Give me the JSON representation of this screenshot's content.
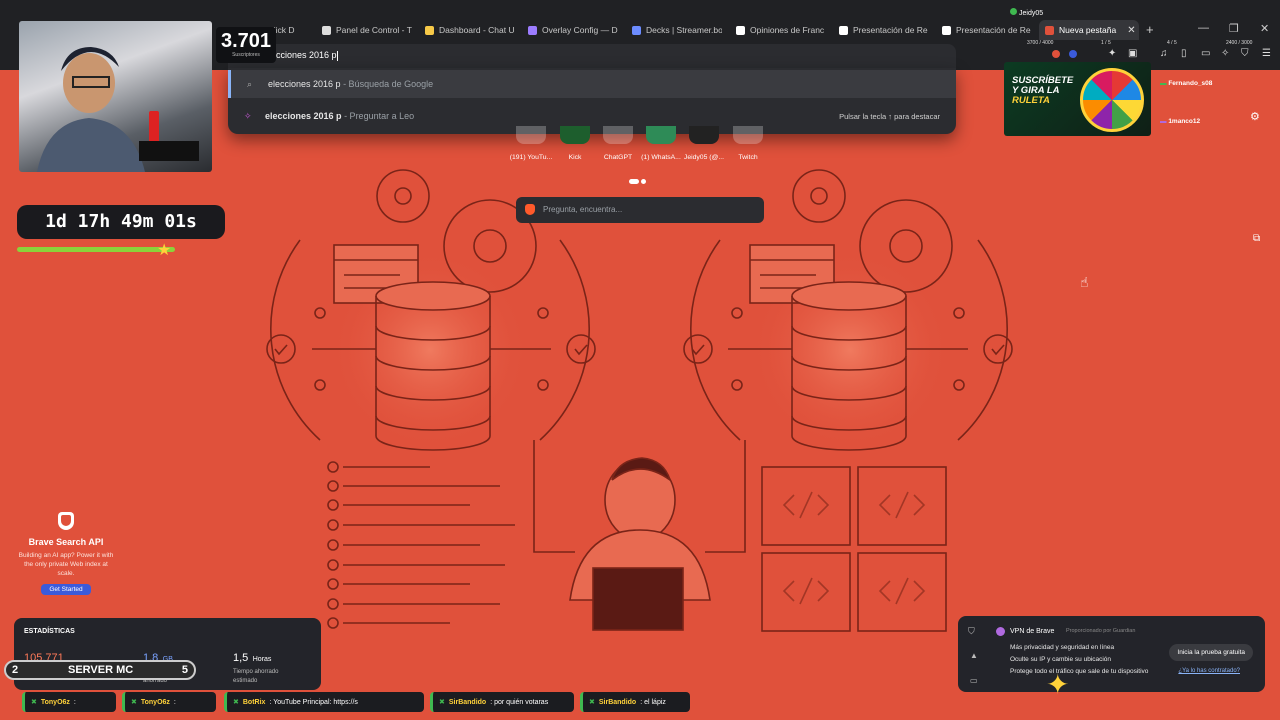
{
  "tabs": [
    {
      "label": "Kick D",
      "color": "#53fc18"
    },
    {
      "label": "Panel de Control - T",
      "color": "#ffffff"
    },
    {
      "label": "Dashboard - Chat U",
      "color": "#f7c948"
    },
    {
      "label": "Overlay Config — D",
      "color": "#9c7cff"
    },
    {
      "label": "Decks | Streamer.bo",
      "color": "#6c8cff"
    },
    {
      "label": "Opiniones de Franc",
      "color": "#ffffff"
    },
    {
      "label": "Presentación de Re",
      "color": "#ffffff"
    },
    {
      "label": "Presentación de Re",
      "color": "#ffffff"
    },
    {
      "label": "Nueva pestaña",
      "color": "#e0513b"
    }
  ],
  "toolbar": {
    "counter_left": "3700 / 4000",
    "counter_mid": "1 / 5",
    "counter_right1": "4 / 5",
    "counter_right2": "2400 / 3000",
    "profile_name": "Jeidy05"
  },
  "omnibox": {
    "query": "elecciones 2016 p",
    "suggestions": [
      {
        "main": "elecciones 2016 p",
        "sub": " - Búsqueda de Google",
        "icon": "search-icon",
        "hint": ""
      },
      {
        "main": "elecciones 2016 p",
        "sub": " - Preguntar a Leo",
        "icon": "leo-icon",
        "hint": "Pulsar la tecla ↑ para destacar"
      }
    ]
  },
  "shortcuts": [
    {
      "label": "(191) YouTu..."
    },
    {
      "label": "Kick"
    },
    {
      "label": "ChatGPT"
    },
    {
      "label": "(1) WhatsA..."
    },
    {
      "label": "Jeidy05 (@..."
    },
    {
      "label": "Twitch"
    }
  ],
  "ask": {
    "placeholder": "Pregunta, encuentra..."
  },
  "overlay": {
    "subscribers": "3.701",
    "subscribers_label": "Suscriptores",
    "timer": "1d 17h 49m 01s",
    "timer_progress": 0.76
  },
  "brave_api": {
    "title": "Brave Search API",
    "desc": "Building an AI app? Power it with the only private Web index at scale.",
    "button": "Get Started"
  },
  "stats": {
    "heading": "ESTADÍSTICAS",
    "items": [
      {
        "value": "105.771",
        "unit": "",
        "label": "",
        "color": "#ff7a59"
      },
      {
        "value": "1,8",
        "unit": "GB",
        "label": "Ancho de banda ahorrado",
        "color": "#7aa2ff"
      },
      {
        "value": "1,5",
        "unit": "Horas",
        "label": "Tiempo ahorrado estimado",
        "color": "#ffffff"
      }
    ]
  },
  "server": {
    "left": "2",
    "title": "SERVER MC",
    "right": "5"
  },
  "chat": [
    {
      "user": "TonyO6z",
      "text": ":"
    },
    {
      "user": "TonyO6z",
      "text": ":"
    },
    {
      "user": "BotRix",
      "text": ": YouTube Principal: https://s"
    },
    {
      "user": "SirBandido",
      "text": ": por quién votaras"
    },
    {
      "user": "SirBandido",
      "text": ": el lápiz"
    }
  ],
  "roulette": {
    "line1": "SUSCRÍBETE",
    "line2": "Y GIRA LA",
    "line3": "RULETA"
  },
  "side_users": [
    {
      "name": "Fernando_s08"
    },
    {
      "name": "1manco12"
    }
  ],
  "vpn": {
    "title": "VPN de Brave",
    "provided_by": "Proporcionado por Guardian",
    "lines": [
      "Más privacidad y seguridad en línea",
      "Oculte su IP y cambie su ubicación",
      "Protege todo el tráfico que sale de tu dispositivo"
    ],
    "trial_button": "Inicia la prueba gratuita",
    "have_link": "¿Ya lo has contratado?"
  },
  "colors": {
    "background": "#e0513b",
    "line": "#7a2418",
    "chrome": "#202124",
    "accent": "#8ab4f8"
  }
}
